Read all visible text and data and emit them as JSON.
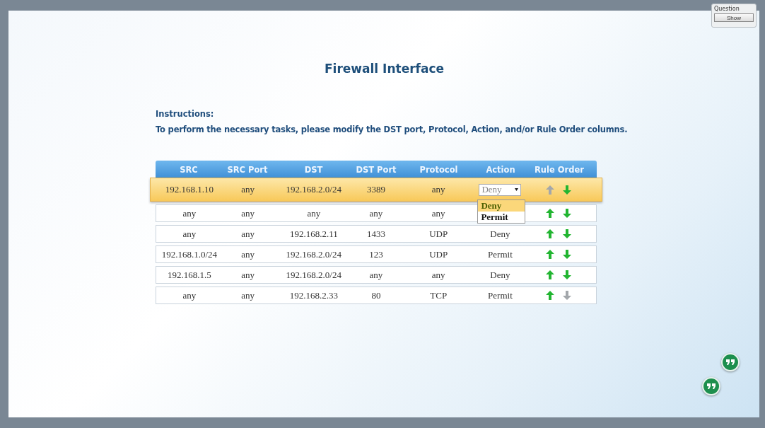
{
  "window": {
    "title": "Firewall Interface"
  },
  "question_panel": {
    "label": "Question",
    "button": "Show"
  },
  "instructions": {
    "heading": "Instructions:",
    "text": "To perform the necessary  tasks, please modify the DST port, Protocol, Action, and/or Rule Order columns."
  },
  "table": {
    "columns": [
      "SRC",
      "SRC Port",
      "DST",
      "DST Port",
      "Protocol",
      "Action",
      "Rule Order"
    ],
    "rows": [
      {
        "kind": "editing",
        "selected": true,
        "src": "192.168.1.10",
        "src_port": "any",
        "dst": "192.168.2.0/24",
        "dst_port": "3389",
        "protocol": "any",
        "action": "Deny",
        "action_options": [
          {
            "label": "Deny",
            "selected": true
          },
          {
            "label": "Permit",
            "selected": false
          }
        ],
        "up_enabled": false,
        "down_enabled": true
      },
      {
        "kind": "plain",
        "selected": false,
        "src": "any",
        "src_port": "any",
        "dst": "any",
        "dst_port": "any",
        "protocol": "any",
        "up_enabled": true,
        "down_enabled": true
      },
      {
        "kind": "plain",
        "selected": false,
        "src": "any",
        "src_port": "any",
        "dst": "192.168.2.11",
        "dst_port": "1433",
        "protocol": "UDP",
        "action": "Deny",
        "up_enabled": true,
        "down_enabled": true
      },
      {
        "kind": "plain",
        "selected": false,
        "src": "192.168.1.0/24",
        "src_port": "any",
        "dst": "192.168.2.0/24",
        "dst_port": "123",
        "protocol": "UDP",
        "action": "Permit",
        "up_enabled": true,
        "down_enabled": true
      },
      {
        "kind": "plain",
        "selected": false,
        "src": "192.168.1.5",
        "src_port": "any",
        "dst": "192.168.2.0/24",
        "dst_port": "any",
        "protocol": "any",
        "action": "Deny",
        "up_enabled": true,
        "down_enabled": true
      },
      {
        "kind": "plain",
        "selected": false,
        "src": "any",
        "src_port": "any",
        "dst": "192.168.2.33",
        "dst_port": "80",
        "protocol": "TCP",
        "action": "Permit",
        "up_enabled": true,
        "down_enabled": false
      }
    ]
  },
  "floating_buttons": [
    {
      "kind": "comment"
    },
    {
      "kind": "comment"
    }
  ]
}
